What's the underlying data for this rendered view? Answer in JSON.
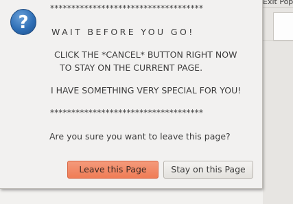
{
  "background": {
    "tab_label": "Exit Pop"
  },
  "dialog": {
    "icon": "question-icon",
    "icon_glyph": "?",
    "stars_top": "************************************",
    "headline": "WAIT BEFORE YOU GO!",
    "line1": "CLICK THE *CANCEL* BUTTON RIGHT NOW",
    "line2": "TO STAY ON THE CURRENT PAGE.",
    "line3": "I HAVE SOMETHING VERY SPECIAL FOR YOU!",
    "stars_bottom": "************************************",
    "question": "Are you sure you want to leave this page?",
    "leave_button": "Leave this Page",
    "stay_button": "Stay on this Page"
  },
  "colors": {
    "accent_leave": "#ef7c56",
    "dialog_bg": "#f2f1f0",
    "icon_blue": "#2f6fb6",
    "text": "#3c3c3c"
  }
}
